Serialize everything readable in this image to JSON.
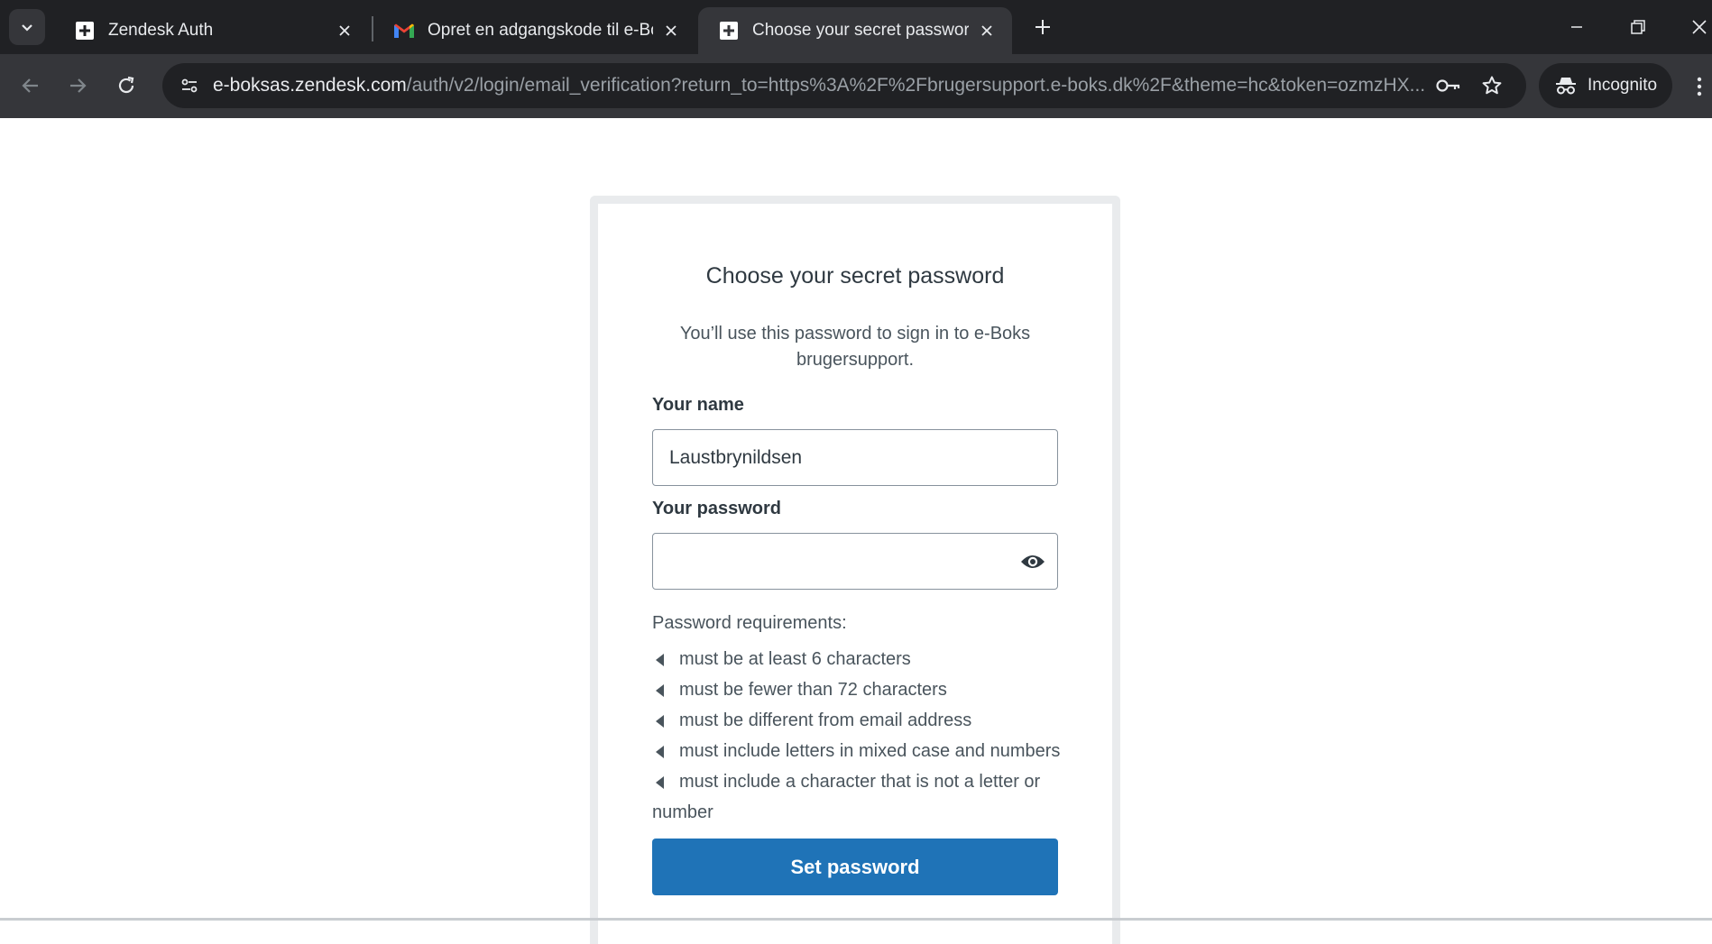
{
  "browser": {
    "tabs": [
      {
        "title": "Zendesk Auth",
        "favicon": "zendesk-icon",
        "active": false
      },
      {
        "title": "Opret en adgangskode til e-Boks",
        "favicon": "gmail-icon",
        "active": false
      },
      {
        "title": "Choose your secret password",
        "favicon": "zendesk-icon",
        "active": true
      }
    ],
    "url_host": "e-boksas.zendesk.com",
    "url_path": "/auth/v2/login/email_verification?return_to=https%3A%2F%2Fbrugersupport.e-boks.dk%2F&theme=hc&token=ozmzHX...",
    "incognito_label": "Incognito"
  },
  "form": {
    "heading": "Choose your secret password",
    "subtitle": "You’ll use this password to sign in to e-Boks brugersupport.",
    "name_label": "Your name",
    "name_value": "Laustbrynildsen",
    "password_label": "Your password",
    "password_value": "",
    "requirements_title": "Password requirements:",
    "requirements": [
      "must be at least 6 characters",
      "must be fewer than 72 characters",
      "must be different from email address",
      "must include letters in mixed case and numbers",
      "must include a character that is not a letter or number"
    ],
    "submit_label": "Set password"
  },
  "colors": {
    "primary_button": "#1f73b7",
    "chrome_dark": "#202124",
    "chrome_mid": "#35363a"
  }
}
